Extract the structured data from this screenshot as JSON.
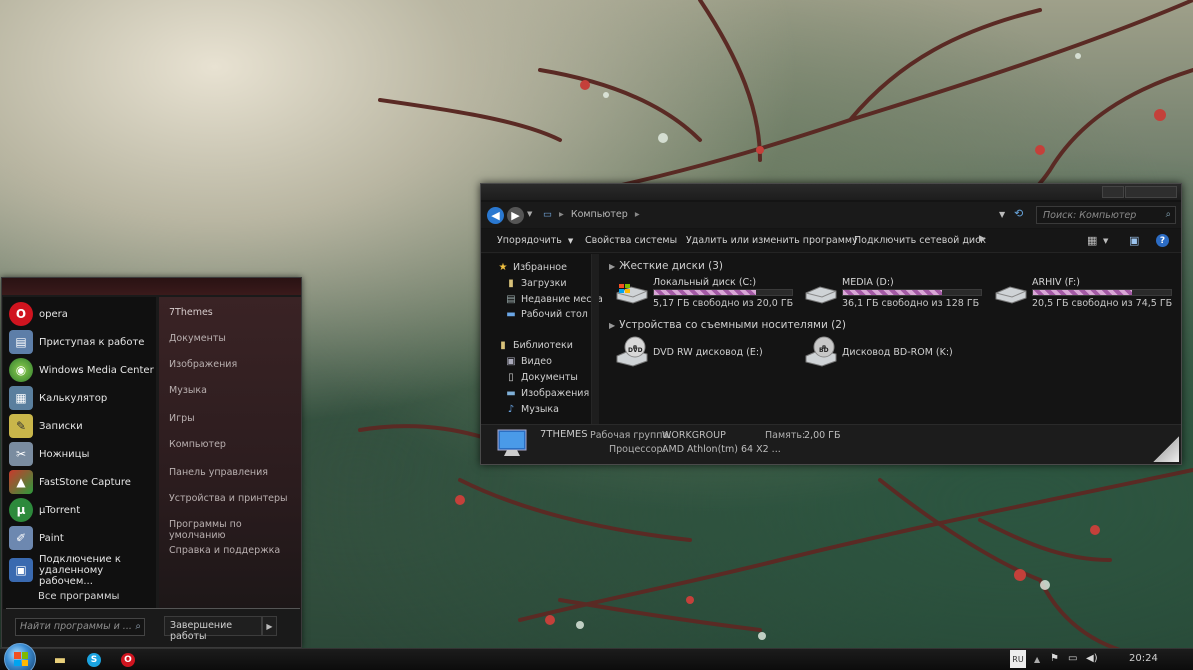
{
  "start_menu": {
    "pinned": [
      {
        "label": "opera",
        "icon": "opera-icon",
        "color": "#d0141f",
        "glyph": "O"
      },
      {
        "label": "Приступая к работе",
        "icon": "getting-started-icon",
        "color": "#5d7ea8",
        "glyph": "▤"
      },
      {
        "label": "Windows Media Center",
        "icon": "media-center-icon",
        "color": "#3a8a3a",
        "glyph": "◉"
      },
      {
        "label": "Калькулятор",
        "icon": "calculator-icon",
        "color": "#5a7f9e",
        "glyph": "▦"
      },
      {
        "label": "Записки",
        "icon": "sticky-notes-icon",
        "color": "#c9b64a",
        "glyph": "✎"
      },
      {
        "label": "Ножницы",
        "icon": "snipping-tool-icon",
        "color": "#7a8ca0",
        "glyph": "✂"
      },
      {
        "label": "FastStone Capture",
        "icon": "faststone-icon",
        "color": "#c93a2d",
        "glyph": "▲"
      },
      {
        "label": "µTorrent",
        "icon": "utorrent-icon",
        "color": "#2d8a3c",
        "glyph": "µ"
      },
      {
        "label": "Paint",
        "icon": "paint-icon",
        "color": "#6d88b0",
        "glyph": "✐"
      },
      {
        "label": "Подключение к удаленному рабочем...",
        "icon": "remote-desktop-icon",
        "color": "#3a6ab0",
        "glyph": "▣"
      }
    ],
    "all_programs": "Все программы",
    "search_placeholder": "Найти программы и ...",
    "places": [
      "7Themes",
      "Документы",
      "Изображения",
      "Музыка",
      "Игры",
      "Компьютер",
      "Панель управления",
      "Устройства и принтеры",
      "Программы по умолчанию",
      "Справка и поддержка"
    ],
    "shutdown": "Завершение работы"
  },
  "explorer": {
    "address": "Компьютер",
    "search_placeholder": "Поиск: Компьютер",
    "toolbar": {
      "organize": "Упорядочить",
      "system_properties": "Свойства системы",
      "uninstall": "Удалить или изменить программу",
      "map_drive": "Подключить сетевой диск"
    },
    "nav": {
      "favorites": "Избранное",
      "downloads": "Загрузки",
      "recent": "Недавние места",
      "desktop": "Рабочий стол",
      "libraries": "Библиотеки",
      "video": "Видео",
      "documents": "Документы",
      "pictures": "Изображения",
      "music": "Музыка"
    },
    "hard_drives_header": "Жесткие диски (3)",
    "drives": [
      {
        "name": "Локальный диск (C:)",
        "free": "5,17 ГБ свободно из 20,0 ГБ",
        "used_fraction": 0.74
      },
      {
        "name": "MEDIA (D:)",
        "free": "36,1 ГБ свободно из 128 ГБ",
        "used_fraction": 0.72
      },
      {
        "name": "ARHIV (F:)",
        "free": "20,5 ГБ свободно из 74,5 ГБ",
        "used_fraction": 0.72
      }
    ],
    "removable_header": "Устройства со съемными носителями (2)",
    "removable": [
      {
        "name": "DVD RW дисковод (E:)",
        "badge": "DVD"
      },
      {
        "name": "Дисковод BD-ROM (K:)",
        "badge": "BD"
      }
    ],
    "details": {
      "computer_name": "7THEMES",
      "workgroup_label": "Рабочая группа:",
      "workgroup": "WORKGROUP",
      "memory_label": "Память:",
      "memory": "2,00 ГБ",
      "cpu_label": "Процессор:",
      "cpu": "AMD Athlon(tm) 64 X2 ..."
    }
  },
  "taskbar": {
    "language": "RU",
    "clock": "20:24"
  }
}
